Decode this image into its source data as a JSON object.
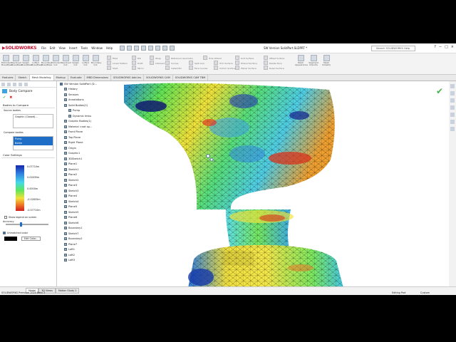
{
  "app": {
    "logo": "SOLIDWORKS",
    "menus": [
      "File",
      "Edit",
      "View",
      "Insert",
      "Tools",
      "Window",
      "Help"
    ],
    "doc_title": "SW Version SolidPart.SLDPRT *",
    "search_placeholder": "Search SOLIDWORKS Help",
    "window_controls": [
      "?",
      "−",
      "□",
      "×"
    ]
  },
  "ribbon": {
    "big_buttons": [
      "Extruded Boss/Base",
      "Revolved Boss/Base",
      "Swept Boss/Base",
      "Lofted Boss/Base",
      "Boundary Boss/Base",
      "Extruded Cut",
      "Revolved Cut",
      "Swept Cut",
      "Lofted Cut",
      "Boundary Cut"
    ],
    "small": [
      "Fillet",
      "Linear Pattern",
      "Rib",
      "Wrap",
      "Draft",
      "Intersect",
      "Reference Geometry",
      "Curves",
      "Instant3D",
      "Hole Wizard",
      "Shell",
      "Mirror",
      "Knit Surface",
      "Extend Surface",
      "Planar Surface",
      "Offset Surface",
      "Delete Face",
      "Ruled Surface",
      "Trim Surface",
      "Untrim Surface",
      "Split Line",
      "Face Curves"
    ],
    "right": [
      "Mesh Appearance",
      "Segment Imports",
      "Mesh Simplify"
    ]
  },
  "tabs": [
    {
      "label": "Features",
      "active": false
    },
    {
      "label": "Sketch",
      "active": false
    },
    {
      "label": "Mesh Modeling",
      "active": true
    },
    {
      "label": "Markup",
      "active": false
    },
    {
      "label": "Evaluate",
      "active": false
    },
    {
      "label": "MBD Dimensions",
      "active": false
    },
    {
      "label": "SOLIDWORKS Add-Ins",
      "active": false
    },
    {
      "label": "SOLIDWORKS CAM",
      "active": false
    },
    {
      "label": "SOLIDWORKS CAM TBM",
      "active": false
    }
  ],
  "panel": {
    "title": "Body Compare",
    "ok": "✔",
    "cancel": "✖",
    "bodies_section": "Bodies to Compare",
    "source_label": "Source bodies",
    "source_items": [
      "Graphic (Closed)..."
    ],
    "compare_label": "Compare bodies",
    "compare_items": [
      "Pump",
      "Bottle"
    ],
    "color_section": "Color Settings",
    "scale_values": [
      "0.07710m",
      "0.02835m",
      "0.0000m",
      "-0.02835m",
      "-0.07710m"
    ],
    "show_legend": "Show legend on screen",
    "accuracy": "Accuracy",
    "unmatched": "Unmatched color",
    "edit_color": "Edit Color..."
  },
  "tree": [
    "SW Version SolidPart (D...",
    "History",
    "Sensors",
    "Annotations",
    "Solid Bodies(2)",
    "Pump",
    "Dynamic Imbu",
    "Graphic Bodies(1)",
    "Material <not sp...",
    "Front Plane",
    "Top Plane",
    "Right Plane",
    "Origin",
    "Graphic1",
    "3DSketch1",
    "Plane1",
    "Sketch1",
    "Plane2",
    "Sketch2",
    "Plane3",
    "Sketch3",
    "Plane4",
    "Sketch4",
    "Plane5",
    "Sketch5",
    "Plane6",
    "Sketch6",
    "Boundary1",
    "Sketch7",
    "Boundary2",
    "Plane7",
    "Loft1",
    "Loft2",
    "Loft3"
  ],
  "status": {
    "product": "SOLIDWORKS Premium 2020 Beta 3",
    "bottom_tabs": [
      "Model",
      "3D Views",
      "Motion Study 1"
    ],
    "state": "Editing Part",
    "units": "Custom"
  },
  "colors": {
    "accent": "#1e6ec7",
    "brand": "#c8102e",
    "ok": "#4caf50"
  }
}
